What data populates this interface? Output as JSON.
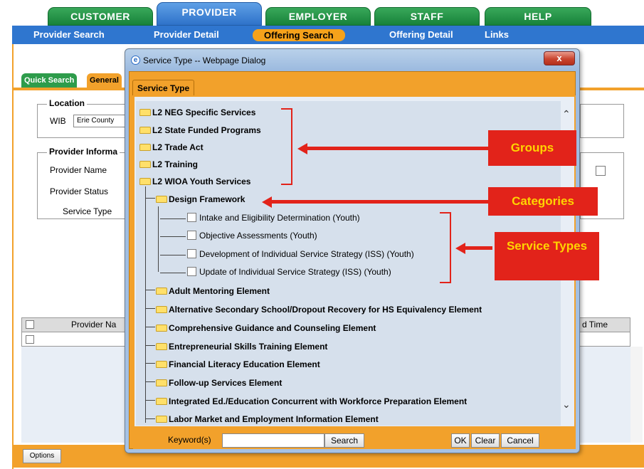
{
  "main_tabs": [
    "CUSTOMER",
    "PROVIDER",
    "EMPLOYER",
    "STAFF",
    "HELP"
  ],
  "sub_nav": [
    "Provider Search",
    "Provider Detail",
    "Offering Search",
    "Offering Detail",
    "Links"
  ],
  "search_tabs": {
    "quick": "Quick Search",
    "general": "General"
  },
  "location": {
    "legend": "Location",
    "wib_label": "WIB",
    "wib_value": "Erie County"
  },
  "provider_info": {
    "legend": "Provider Informa",
    "name_label": "Provider Name",
    "status_label": "Provider Status",
    "service_type_label": "Service Type"
  },
  "grid": {
    "col_provider": "Provider Na",
    "col_end_time": "d Time"
  },
  "options_button": "Options",
  "dialog": {
    "title": "Service Type -- Webpage Dialog",
    "close": "x",
    "tab": "Service Type",
    "groups": [
      "L2 NEG Specific Services",
      "L2 State Funded Programs",
      "L2 Trade Act",
      "L2 Training",
      "L2 WIOA Youth Services"
    ],
    "category": "Design Framework",
    "service_types": [
      "Intake and Eligibility Determination (Youth)",
      "Objective Assessments (Youth)",
      "Development of Individual Service Strategy (ISS) (Youth)",
      "Update of Individual Service Strategy (ISS) (Youth)"
    ],
    "elements": [
      "Adult Mentoring Element",
      "Alternative Secondary School/Dropout Recovery for HS Equivalency Element",
      "Comprehensive Guidance and Counseling Element",
      "Entrepreneurial Skills Training Element",
      "Financial Literacy Education Element",
      "Follow-up Services Element",
      "Integrated Ed./Education Concurrent with Workforce Preparation Element",
      "Labor Market and Employment Information Element"
    ],
    "keyword_label": "Keyword(s)",
    "keyword_value": "",
    "search_button": "Search",
    "ok_button": "OK",
    "clear_button": "Clear",
    "cancel_button": "Cancel"
  },
  "annotations": {
    "groups": "Groups",
    "categories": "Categories",
    "service_types": "Service Types"
  },
  "colors": {
    "green_tab": "#17823a",
    "blue_nav": "#2f76cf",
    "orange": "#f2a12b",
    "annotation_red": "#e2231a",
    "annotation_text": "#ffd400"
  }
}
